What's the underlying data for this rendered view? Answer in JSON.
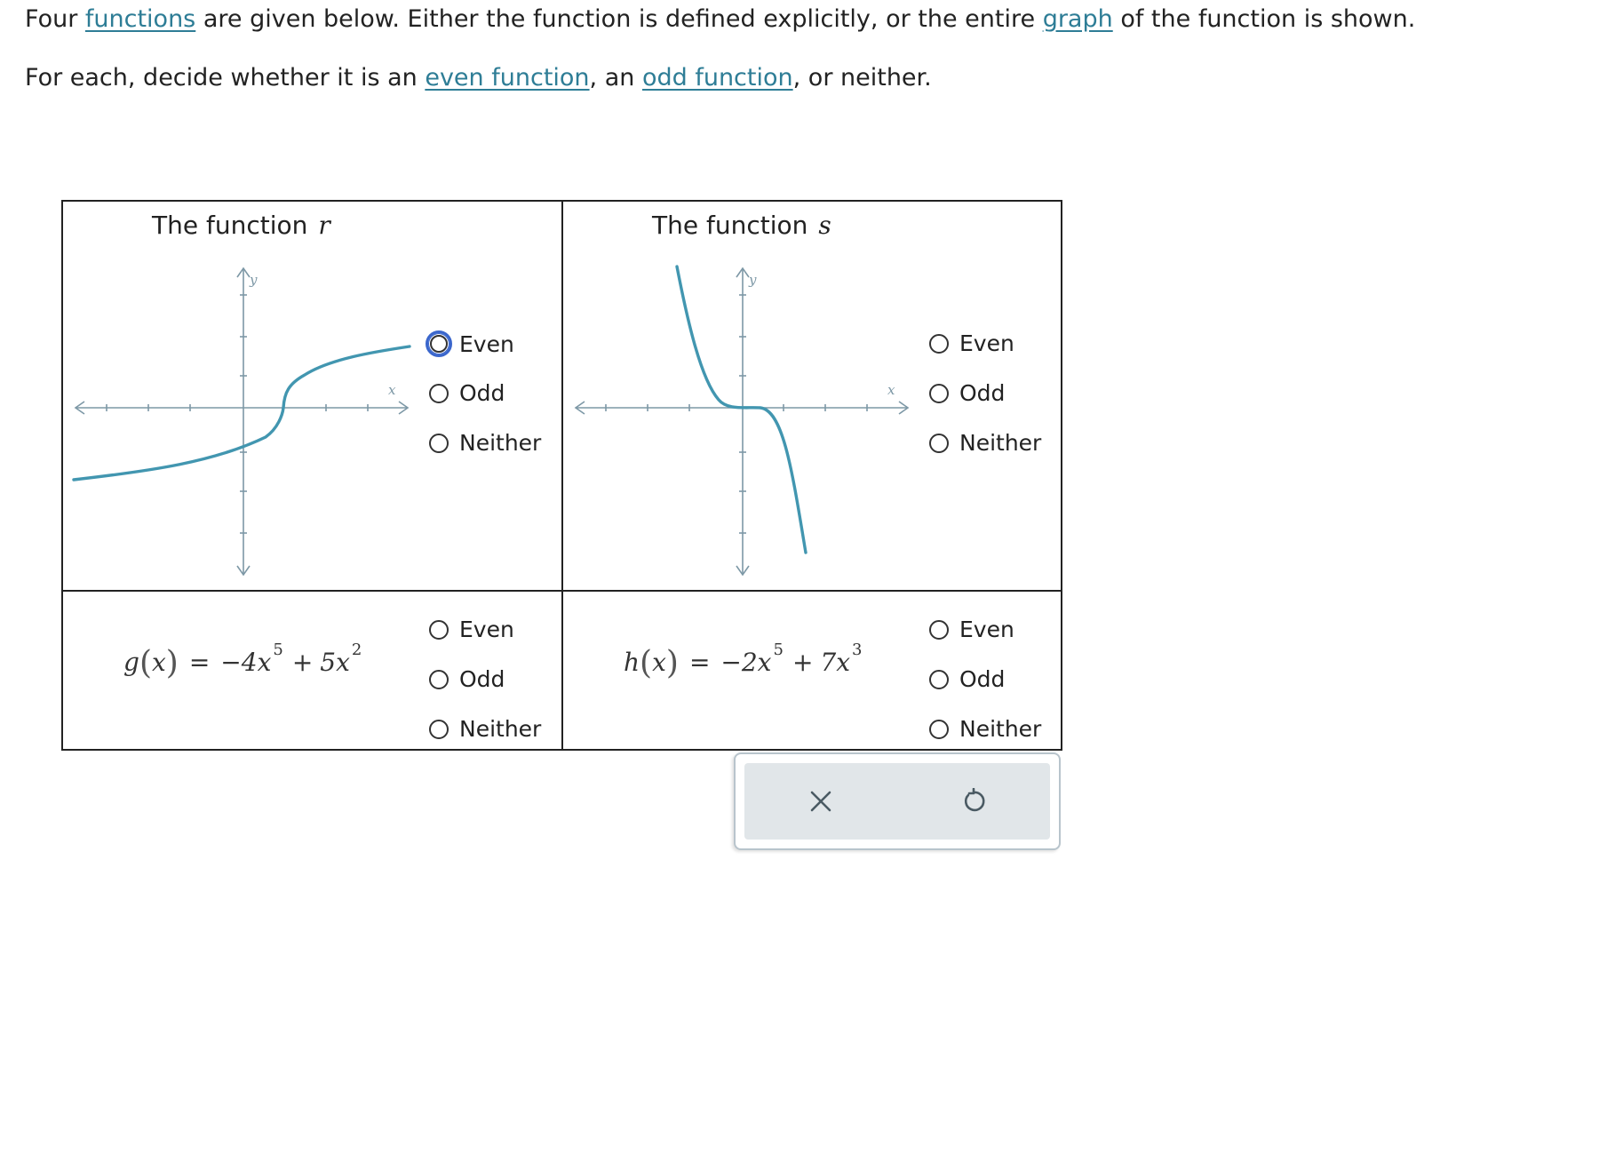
{
  "intro": {
    "line1": {
      "t1": "Four ",
      "link_functions": "functions",
      "t2": " are given below. Either the function is defined explicitly, or the entire ",
      "link_graph": "graph",
      "t3": " of the function is shown."
    },
    "line2": {
      "t1": "For each, decide whether it is an ",
      "link_even": "even function",
      "t2": ", an ",
      "link_odd": "odd function",
      "t3": ", or neither."
    }
  },
  "cells": {
    "r": {
      "title": "The function",
      "var": "r",
      "axis_x": "x",
      "axis_y": "y",
      "options": [
        "Even",
        "Odd",
        "Neither"
      ],
      "focused_option": "Even"
    },
    "s": {
      "title": "The function",
      "var": "s",
      "axis_x": "x",
      "axis_y": "y",
      "options": [
        "Even",
        "Odd",
        "Neither"
      ]
    },
    "g": {
      "name": "g",
      "arg": "x",
      "eq": "=",
      "term1_coef": "−4x",
      "term1_exp": "5",
      "op": "+",
      "term2_coef": "5x",
      "term2_exp": "2",
      "options": [
        "Even",
        "Odd",
        "Neither"
      ]
    },
    "h": {
      "name": "h",
      "arg": "x",
      "eq": "=",
      "term1_coef": "−2x",
      "term1_exp": "5",
      "op": "+",
      "term2_coef": "7x",
      "term2_exp": "3",
      "options": [
        "Even",
        "Odd",
        "Neither"
      ]
    }
  },
  "colors": {
    "curve": "#4296b0",
    "axis": "#7d98a6",
    "link": "#2e7d96",
    "focus": "#3a66cc"
  },
  "toolbar": {
    "clear_icon": "close-icon",
    "undo_icon": "undo-icon"
  }
}
